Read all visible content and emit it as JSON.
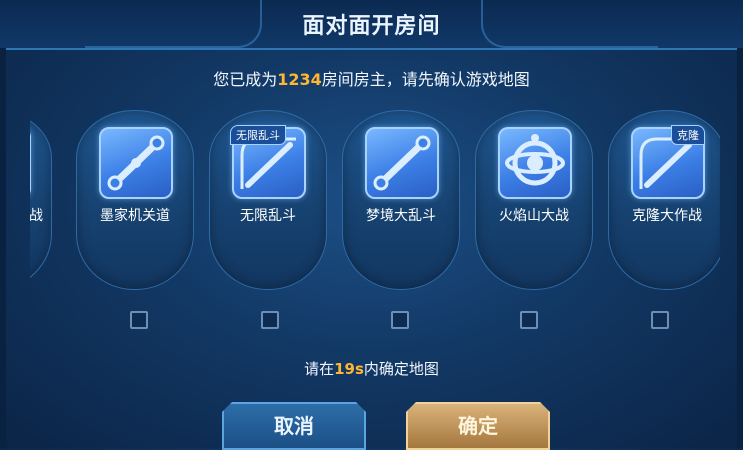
{
  "header": {
    "title": "面对面开房间"
  },
  "prompt": {
    "prefix": "您已成为",
    "room_number": "1234",
    "suffix": "房间房主，请先确认游戏地图"
  },
  "maps": [
    {
      "label": "战",
      "icon": "wrench-icon",
      "tag": ""
    },
    {
      "label": "墨家机关道",
      "icon": "wrench-icon",
      "tag": ""
    },
    {
      "label": "无限乱斗",
      "icon": "wrench-icon",
      "tag": "无限乱斗"
    },
    {
      "label": "梦境大乱斗",
      "icon": "wrench-icon",
      "tag": ""
    },
    {
      "label": "火焰山大战",
      "icon": "orb-icon",
      "tag": ""
    },
    {
      "label": "克隆大作战",
      "icon": "wrench-icon",
      "tag": "克隆"
    }
  ],
  "countdown": {
    "prefix": "请在",
    "seconds": "19s",
    "suffix": "内确定地图"
  },
  "buttons": {
    "cancel": "取消",
    "confirm": "确定"
  },
  "colors": {
    "highlight": "#ffb733",
    "confirm_button": "#c9a062",
    "cancel_button": "#2a66a0"
  }
}
